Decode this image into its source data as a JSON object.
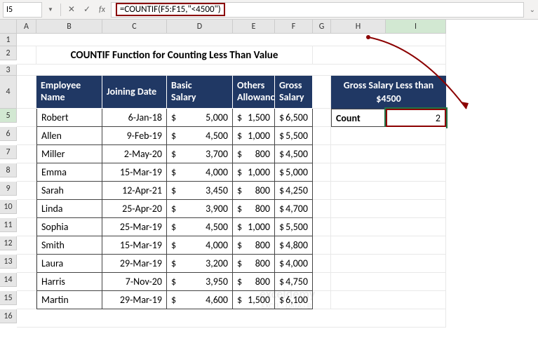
{
  "nameBox": "I5",
  "formula": "=COUNTIF(F5:F15,\"<4500\")",
  "columns": [
    "A",
    "B",
    "C",
    "D",
    "E",
    "F",
    "G",
    "H",
    "I"
  ],
  "rows": [
    "1",
    "2",
    "3",
    "4",
    "5",
    "6",
    "7",
    "8",
    "9",
    "10",
    "11",
    "12",
    "13",
    "14",
    "15",
    "16"
  ],
  "title": "COUNTIF Function for Counting Less Than Value",
  "headers": {
    "empName": "Employee\nName",
    "joinDate": "Joining Date",
    "basic": "Basic\nSalary",
    "others": "Others\nAllowances",
    "gross": "Gross\nSalary"
  },
  "infoHeader": "Gross Salary Less than $4500",
  "countLabel": "Count",
  "countValue": "2",
  "dollar": "$",
  "employees": [
    {
      "name": "Robert",
      "date": "6-Jan-18",
      "basic": "5,000",
      "others": "1,500",
      "gross": "6,500"
    },
    {
      "name": "Allen",
      "date": "9-Feb-19",
      "basic": "4,500",
      "others": "1,000",
      "gross": "5,500"
    },
    {
      "name": "Miller",
      "date": "2-May-20",
      "basic": "3,700",
      "others": "800",
      "gross": "4,500"
    },
    {
      "name": "Emma",
      "date": "15-Mar-19",
      "basic": "4,000",
      "others": "1,000",
      "gross": "5,000"
    },
    {
      "name": "Sarah",
      "date": "12-Apr-21",
      "basic": "3,450",
      "others": "800",
      "gross": "4,250"
    },
    {
      "name": "Linda",
      "date": "25-Apr-20",
      "basic": "3,900",
      "others": "800",
      "gross": "4,700"
    },
    {
      "name": "Sophia",
      "date": "25-Mar-19",
      "basic": "4,500",
      "others": "1,000",
      "gross": "5,500"
    },
    {
      "name": "Smith",
      "date": "15-Mar-19",
      "basic": "4,000",
      "others": "800",
      "gross": "4,800"
    },
    {
      "name": "Laura",
      "date": "29-Mar-19",
      "basic": "3,200",
      "others": "800",
      "gross": "4,000"
    },
    {
      "name": "Harris",
      "date": "7-Nov-20",
      "basic": "3,950",
      "others": "800",
      "gross": "4,750"
    },
    {
      "name": "Martin",
      "date": "29-Mar-19",
      "basic": "4,600",
      "others": "1,500",
      "gross": "6,100"
    }
  ],
  "watermark": {
    "line1": "exceldemy",
    "line2": "EXCEL · DATA · BI"
  }
}
